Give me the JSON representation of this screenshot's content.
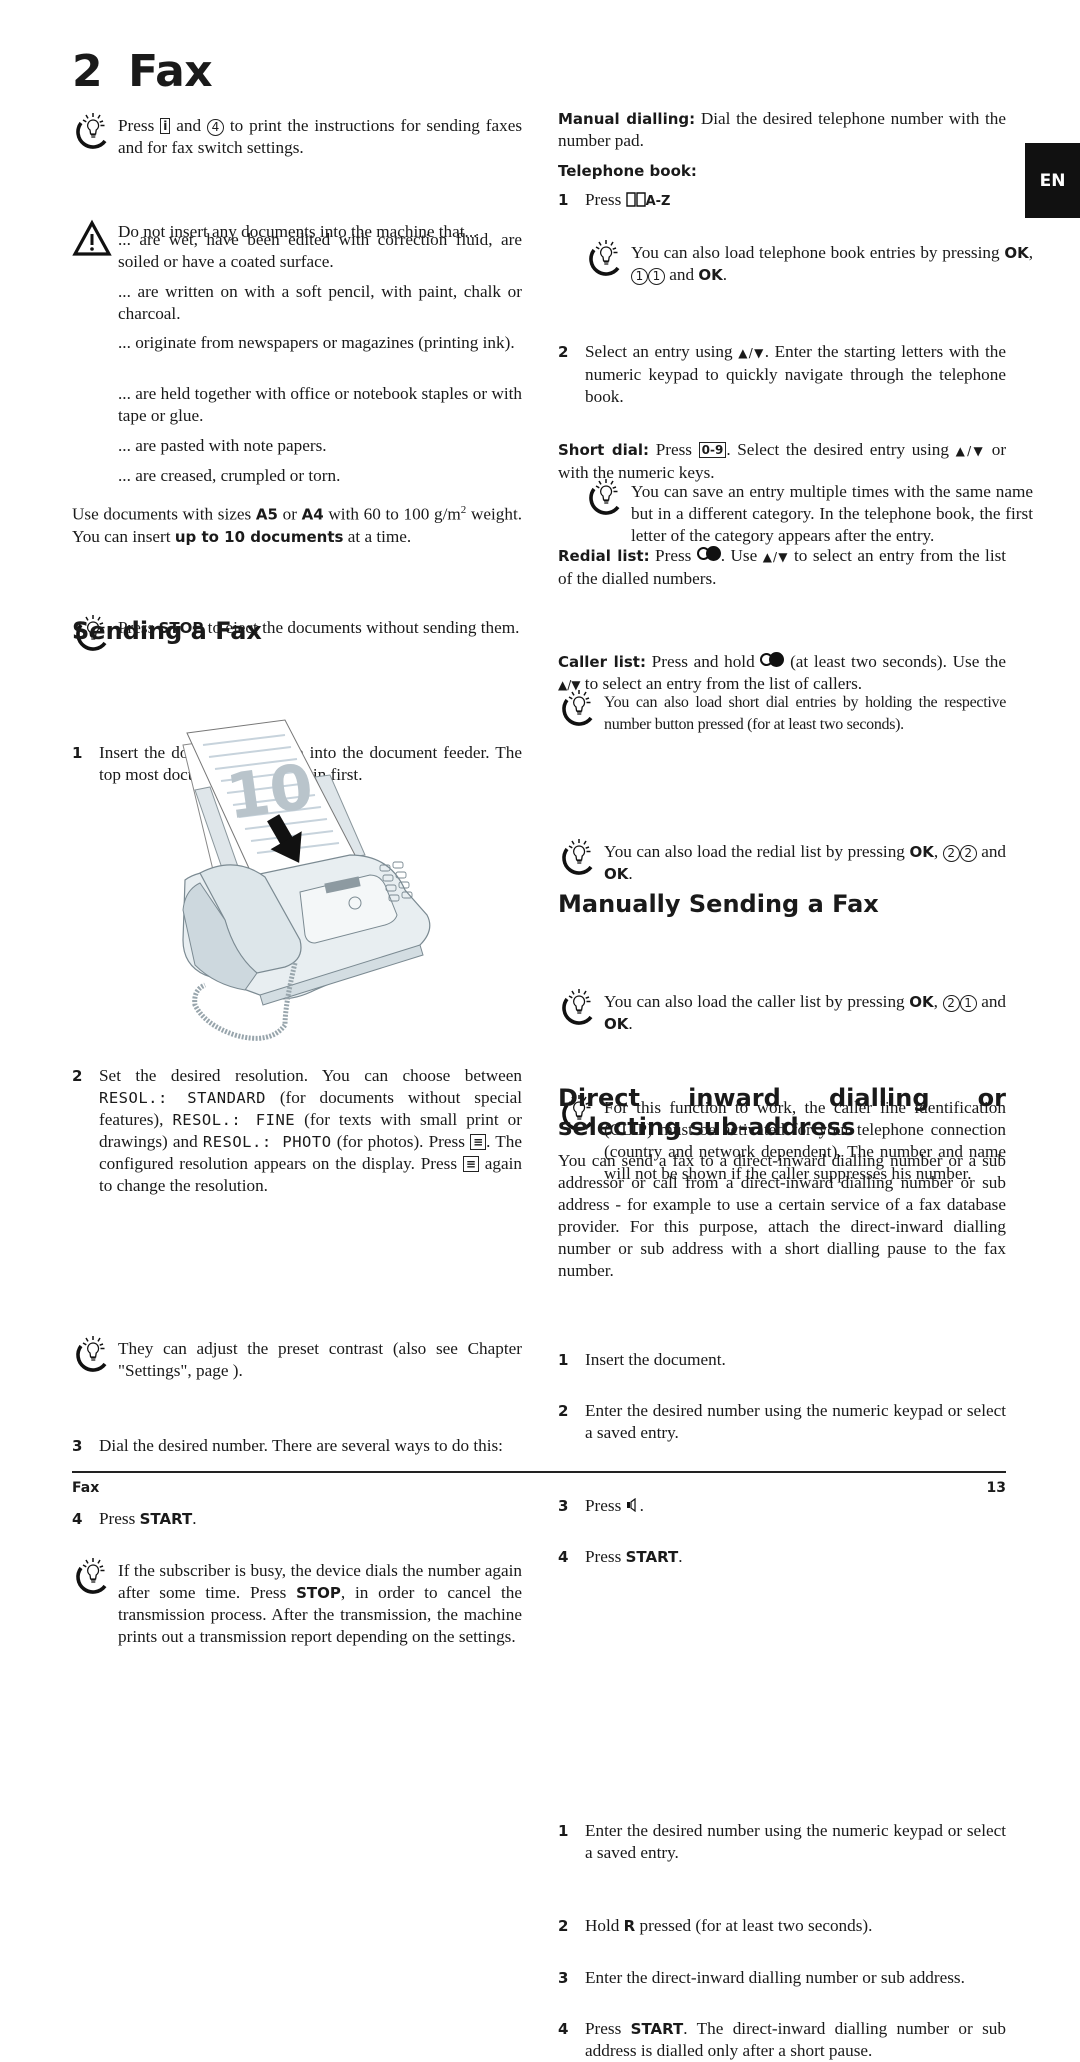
{
  "chapter": {
    "number": "2",
    "title": "Fax"
  },
  "language_tab": "EN",
  "left": {
    "tip_print": {
      "pre": "Press",
      "key_i": "i",
      "and": "and",
      "key_4": "4",
      "post": "to print the instructions for sending faxes and for fax switch settings."
    },
    "warning": "Do not insert any documents into the machine that...",
    "warning_items": [
      "... are wet, have been edited with correction fluid, are soiled or have a coated surface.",
      "... are written on with a soft pencil, with paint, chalk or charcoal.",
      "... originate from newspapers or magazines (printing ink).",
      "... are held together with office or notebook staples or with tape or glue.",
      "... are pasted with note papers.",
      "... are creased, crumpled or torn."
    ],
    "sizes": {
      "t1": "Use documents with sizes",
      "a5": "A5",
      "or": "or",
      "a4": "A4",
      "t2": "with 60 to 100 g/m",
      "sup": "2",
      "t3": "weight. You can insert",
      "bold": "up to 10 documents",
      "t4": "at a time."
    },
    "tip_stop": {
      "pre": "Press",
      "key": "STOP",
      "post": "to eject the documents without sending them."
    },
    "section_sending": "Sending a Fax",
    "step1": {
      "n": "1",
      "text": "Insert the documents face up into the document feeder. The top most document will be fed in first."
    },
    "illustration": {
      "alt": "Fax machine with documents being inserted",
      "stack_label": "10"
    },
    "step2": {
      "n": "2",
      "t1": "Set the desired resolution. You can choose between",
      "opt1": "RESOL.: STANDARD",
      "t2": "(for documents without special features),",
      "opt2": "RESOL.: FINE",
      "t3": "(for texts with small print or drawings) and",
      "opt3": "RESOL.: PHOTO",
      "t4": "(for photos). Press",
      "t5": ". The configured resolution appears on the display. Press",
      "t6": "again to change the resolution."
    },
    "tip_contrast": "They can adjust the preset contrast (also see Chapter \"Settings\", page ).",
    "step3": {
      "n": "3",
      "text": "Dial the desired number. There are several ways to do this:"
    },
    "step4": {
      "n": "4",
      "pre": "Press",
      "key": "START",
      "post": "."
    },
    "tip_busy": {
      "pre": "If the subscriber is busy, the device dials the number again after some time. Press",
      "key": "STOP",
      "post": ", in order to cancel the transmission process. After the transmission, the machine prints out a transmission report depending on the settings."
    }
  },
  "right": {
    "manual_dialling": {
      "label": "Manual dialling:",
      "text": "Dial the desired telephone number with the number pad."
    },
    "telephone_book": {
      "label": "Telephone book:"
    },
    "tb_step1": {
      "n": "1",
      "pre": "Press",
      "key": "A-Z"
    },
    "tip_tb": {
      "pre": "You can also load telephone book entries by pressing",
      "ok": "OK",
      "k1": "1",
      "k2": "1",
      "and": "and",
      "ok2": "OK",
      "end": "."
    },
    "tb_step2": {
      "n": "2",
      "pre": "Select an entry using",
      "arrows": "▲/▼",
      "post": ". Enter the starting letters with the numeric keypad to quickly navigate through the telephone book."
    },
    "tip_category": "You can save an entry multiple times with the same name but in a different category. In the telephone book, the first letter of the category appears after the entry.",
    "short_dial": {
      "label": "Short dial:",
      "pre": "Press",
      "key": "0-9",
      "mid": ". Select the desired entry using",
      "arrows": "▲/▼",
      "post": "or with the numeric keys."
    },
    "tip_short": "You can also load short dial entries by holding the respective number button pressed (for at least two seconds).",
    "redial_list": {
      "label": "Redial list:",
      "pre": "Press",
      "mid": ". Use",
      "arrows": "▲/▼",
      "post": "to select an entry from the list of the dialled numbers."
    },
    "tip_redial": {
      "pre": "You can also load the redial list by pressing",
      "ok": "OK",
      "k1": "2",
      "k2": "2",
      "and": "and",
      "ok2": "OK",
      "end": "."
    },
    "caller_list": {
      "label": "Caller list:",
      "pre": "Press and hold",
      "mid": "(at least two seconds). Use the",
      "arrows": "▲/▼",
      "post": "to select an entry from the list of callers."
    },
    "tip_caller": {
      "pre": "You can also load the caller list by pressing",
      "ok": "OK",
      "k1": "2",
      "k2": "1",
      "and": "and",
      "ok2": "OK",
      "end": "."
    },
    "tip_clip": "For this function to work, the caller line identification (CLIP) must be activated for your telephone connection (country and network dependent). The number and name will not be shown if the caller suppresses his number.",
    "section_manual": "Manually Sending a Fax",
    "manual_steps": [
      {
        "n": "1",
        "text": "Insert the document."
      },
      {
        "n": "2",
        "text": "Enter the desired number using the numeric keypad or select a saved entry."
      },
      {
        "n": "3",
        "text": "Press",
        "icon": "speaker",
        "post": "."
      },
      {
        "n": "4",
        "text": "Press",
        "key": "START",
        "post": "."
      }
    ],
    "section_direct": "Direct inward dialling or selecting sub-address",
    "direct_intro": "You can send a fax to a direct-inward dialling number or a sub addressor or call from a direct-inward dialling number or sub address - for example to use a certain service of a fax database provider. For this purpose, attach the direct-inward dialling number or sub address with a short dialling pause to the fax number.",
    "direct_steps": [
      {
        "n": "1",
        "text": "Enter the desired number using the numeric keypad or select a saved entry."
      },
      {
        "n": "2",
        "pre": "Hold",
        "key": "R",
        "post": "pressed (for at least two seconds)."
      },
      {
        "n": "3",
        "text": "Enter the direct-inward dialling number or sub address."
      },
      {
        "n": "4",
        "pre": "Press",
        "key": "START",
        "post": ". The direct-inward dialling number or sub address is dialled only after a short pause."
      }
    ]
  },
  "footer": {
    "section": "Fax",
    "page": "13"
  }
}
